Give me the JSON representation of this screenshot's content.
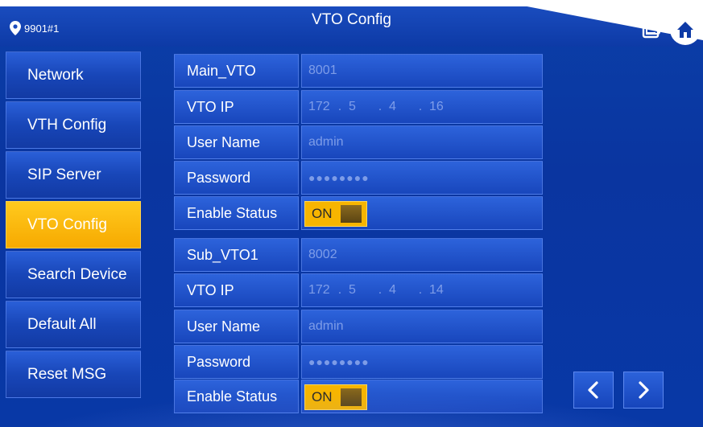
{
  "header": {
    "title": "VTO Config",
    "device_id": "9901#1"
  },
  "sidebar": {
    "items": [
      {
        "label": "Network"
      },
      {
        "label": "VTH Config"
      },
      {
        "label": "SIP Server"
      },
      {
        "label": "VTO Config",
        "active": true
      },
      {
        "label": "Search Device"
      },
      {
        "label": "Default All"
      },
      {
        "label": "Reset MSG"
      }
    ]
  },
  "main_vto": {
    "name_label": "Main_VTO",
    "name_value": "8001",
    "ip_label": "VTO IP",
    "ip_octets": [
      "172",
      "5",
      "4",
      "16"
    ],
    "user_label": "User Name",
    "user_value": "admin",
    "password_label": "Password",
    "password_value": "●●●●●●●●",
    "enable_label": "Enable Status",
    "enable_value": "ON"
  },
  "sub_vto1": {
    "name_label": "Sub_VTO1",
    "name_value": "8002",
    "ip_label": "VTO IP",
    "ip_octets": [
      "172",
      "5",
      "4",
      "14"
    ],
    "user_label": "User Name",
    "user_value": "admin",
    "password_label": "Password",
    "password_value": "●●●●●●●●",
    "enable_label": "Enable Status",
    "enable_value": "ON"
  },
  "icons": {
    "location": "location-pin-icon",
    "messages": "message-box-icon",
    "home": "home-icon",
    "prev": "chevron-left-icon",
    "next": "chevron-right-icon"
  },
  "colors": {
    "background": "#0a35a0",
    "active_tab": "#f7b500",
    "toggle_on": "#f7b500"
  }
}
